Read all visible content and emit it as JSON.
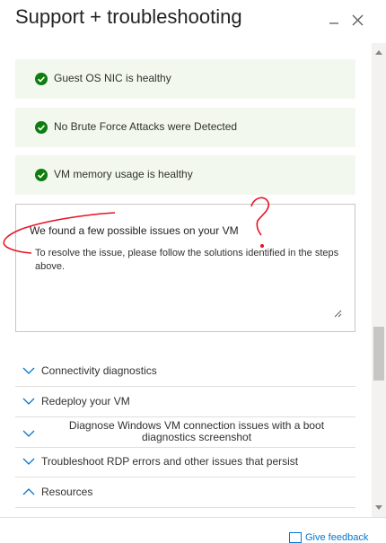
{
  "header": {
    "title": "Support + troubleshooting",
    "minimize_icon": "minimize-icon",
    "close_icon": "close-icon"
  },
  "status_items": [
    {
      "label": "Guest OS NIC is healthy",
      "icon": "check-circle-icon",
      "status": "healthy"
    },
    {
      "label": "No Brute Force Attacks were Detected",
      "icon": "check-circle-icon",
      "status": "healthy"
    },
    {
      "label": "VM memory usage is healthy",
      "icon": "check-circle-icon",
      "status": "healthy"
    }
  ],
  "summary": {
    "title": "We found a few possible issues on your VM",
    "body": "To resolve the issue, please follow the solutions identified in the steps above."
  },
  "accordion": [
    {
      "label": "Connectivity diagnostics",
      "expanded": false
    },
    {
      "label": "Redeploy your VM",
      "expanded": false
    },
    {
      "label": "Diagnose Windows VM connection issues with a boot diagnostics screenshot",
      "expanded": false
    },
    {
      "label": "Troubleshoot RDP errors and other issues that persist",
      "expanded": false
    },
    {
      "label": "Resources",
      "expanded": true
    }
  ],
  "footer": {
    "feedback_label": "Give feedback"
  },
  "colors": {
    "success": "#107c10",
    "card_bg": "#f2f8ed",
    "accent": "#0078d4",
    "annotation": "#e81123"
  }
}
